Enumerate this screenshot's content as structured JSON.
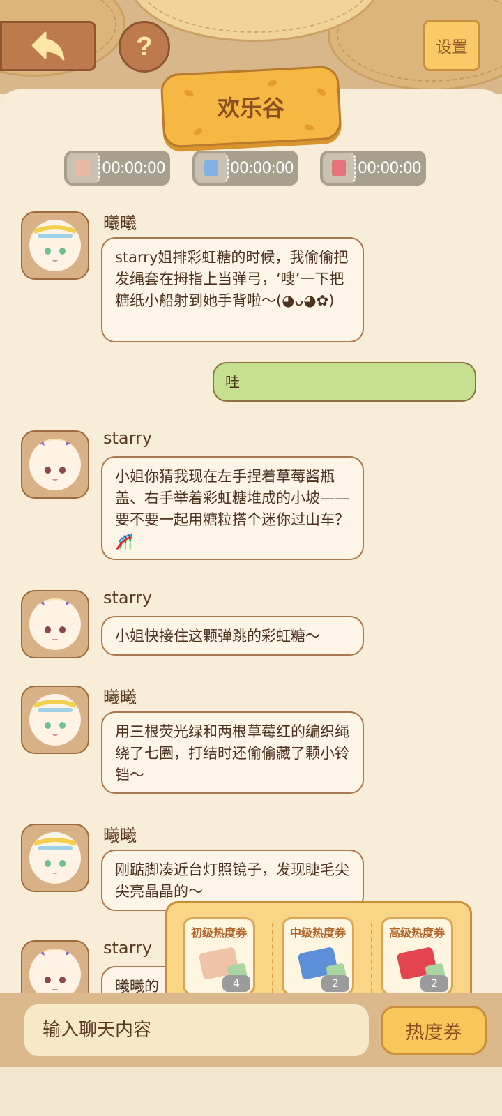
{
  "header": {
    "back_icon": "back-arrow-icon",
    "help_label": "?",
    "settings_label": "设置"
  },
  "room": {
    "title": "欢乐谷",
    "timers": [
      {
        "icon": "ticket-beige-icon",
        "time": "00:00:00",
        "color": "#e8b9a4"
      },
      {
        "icon": "ticket-blue-icon",
        "time": "00:00:00",
        "color": "#7fb1e3"
      },
      {
        "icon": "ticket-red-icon",
        "time": "00:00:00",
        "color": "#e4737c"
      }
    ]
  },
  "messages": [
    {
      "sender": "曦曦",
      "side": "left",
      "text": "starry姐排彩虹糖的时候，我偷偷把发绳套在拇指上当弹弓，‘嗖’一下把糖纸小船射到她手背啦～(◕ᴗ◕✿)"
    },
    {
      "sender": "",
      "side": "right",
      "text": "哇"
    },
    {
      "sender": "starry",
      "side": "left",
      "text": "小姐你猜我现在左手捏着草莓酱瓶盖、右手举着彩虹糖堆成的小坡——要不要一起用糖粒搭个迷你过山车？🎢"
    },
    {
      "sender": "starry",
      "side": "left",
      "text": "小姐快接住这颗弹跳的彩虹糖～"
    },
    {
      "sender": "曦曦",
      "side": "left",
      "text": "用三根荧光绿和两根草莓红的编织绳绕了七圈，打结时还偷偷藏了颗小铃铛～"
    },
    {
      "sender": "曦曦",
      "side": "left",
      "text": "刚踮脚凑近台灯照镜子，发现睫毛尖尖亮晶晶的～"
    },
    {
      "sender": "starry",
      "side": "left",
      "text": "曦曦的"
    }
  ],
  "coupons": [
    {
      "name": "初级热度券",
      "count": "4",
      "color": "#f0c2a8"
    },
    {
      "name": "中级热度券",
      "count": "2",
      "color": "#5d8fd8"
    },
    {
      "name": "高级热度券",
      "count": "2",
      "color": "#e2454f"
    }
  ],
  "input": {
    "placeholder": "输入聊天内容",
    "send_coupon_label": "热度券"
  }
}
